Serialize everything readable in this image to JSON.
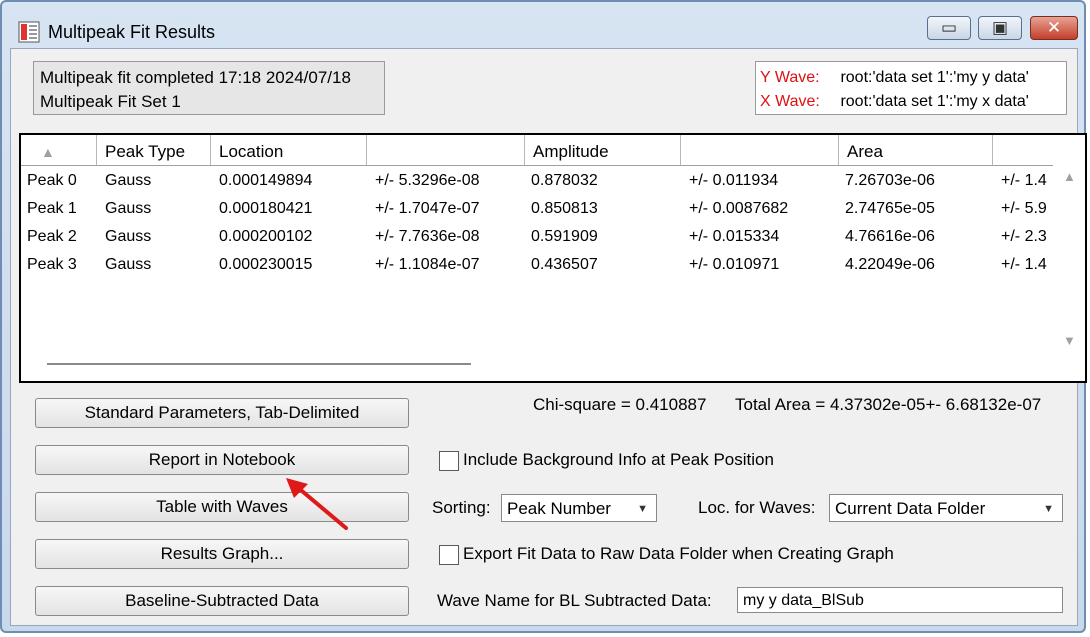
{
  "window": {
    "title": "Multipeak Fit Results",
    "minimize_glyph": "▭",
    "maximize_glyph": "▣",
    "close_glyph": "✕"
  },
  "info": {
    "line1": "Multipeak fit completed 17:18 2024/07/18",
    "line2": "Multipeak Fit Set 1"
  },
  "waves": {
    "y_label": "Y Wave:",
    "y_value": "root:'data set 1':'my y data'",
    "x_label": "X Wave:",
    "x_value": "root:'data set 1':'my x data'"
  },
  "table": {
    "sort_glyph": "▲",
    "headers": [
      "",
      "Peak Type",
      "Location",
      "",
      "Amplitude",
      "",
      "Area",
      ""
    ],
    "rows": [
      [
        "Peak 0",
        "Gauss",
        "0.000149894",
        "+/- 5.3296e-08",
        "0.878032",
        "+/- 0.011934",
        "7.26703e-06",
        "+/- 1.4"
      ],
      [
        "Peak 1",
        "Gauss",
        "0.000180421",
        "+/- 1.7047e-07",
        "0.850813",
        "+/- 0.0087682",
        "2.74765e-05",
        "+/- 5.9"
      ],
      [
        "Peak 2",
        "Gauss",
        "0.000200102",
        "+/- 7.7636e-08",
        "0.591909",
        "+/- 0.015334",
        "4.76616e-06",
        "+/- 2.3"
      ],
      [
        "Peak 3",
        "Gauss",
        "0.000230015",
        "+/- 1.1084e-07",
        "0.436507",
        "+/- 0.010971",
        "4.22049e-06",
        "+/- 1.4"
      ]
    ],
    "scroll_up_glyph": "▲",
    "scroll_down_glyph": "▼"
  },
  "stats": {
    "chi_square": "Chi-square = 0.410887",
    "total_area": "Total Area = 4.37302e-05+- 6.68132e-07"
  },
  "buttons": {
    "standard_params": "Standard Parameters, Tab-Delimited",
    "report_notebook": "Report in Notebook",
    "table_waves": "Table with Waves",
    "results_graph": "Results Graph...",
    "baseline_subtracted": "Baseline-Subtracted Data"
  },
  "options": {
    "include_bg_label": "Include Background Info at Peak Position",
    "include_bg_checked": false,
    "sorting_label": "Sorting:",
    "sorting_value": "Peak Number",
    "loc_label": "Loc. for Waves:",
    "loc_value": "Current Data Folder",
    "export_label": "Export Fit Data to Raw Data Folder when Creating Graph",
    "export_checked": false,
    "wave_name_label": "Wave Name for BL Subtracted Data:",
    "wave_name_value": "my y data_BlSub",
    "dropdown_glyph": "▼"
  },
  "colors": {
    "wave_label": "#e01010",
    "annotation_arrow": "#e01818"
  }
}
